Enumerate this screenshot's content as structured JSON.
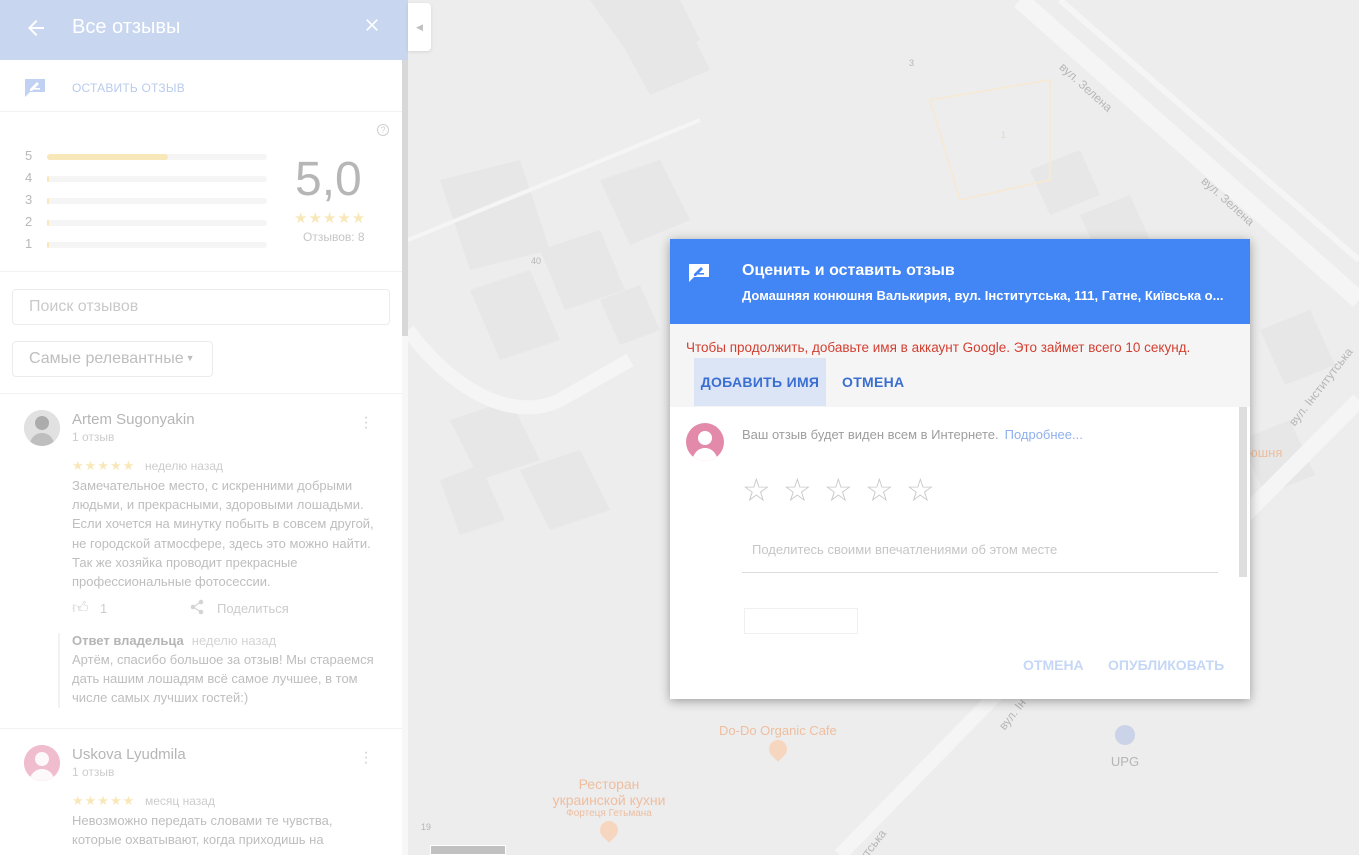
{
  "panel": {
    "title": "Все отзывы",
    "back_icon": "arrow-left-icon",
    "close_icon": "close-icon",
    "write_review_label": "ОСТАВИТЬ ОТЗЫВ",
    "rating": {
      "value": "5,0",
      "stars": "★★★★★",
      "count_label": "Отзывов: 8",
      "histogram": [
        {
          "label": "5",
          "fraction": 0.55
        },
        {
          "label": "4",
          "fraction": 0.0
        },
        {
          "label": "3",
          "fraction": 0.0
        },
        {
          "label": "2",
          "fraction": 0.0
        },
        {
          "label": "1",
          "fraction": 0.0
        }
      ]
    },
    "search_placeholder": "Поиск отзывов",
    "sort_label": "Самые релевантные",
    "reviews": [
      {
        "author": "Artem Sugonyakin",
        "count": "1 отзыв",
        "stars": "★★★★★",
        "when": "неделю назад",
        "text": "Замечательное место, с искренними добрыми людьми, и прекрасными, здоровыми лошадьми. Если хочется на минутку побыть в совсем другой, не городской атмосфере, здесь  это можно найти. Так же хозяйка проводит прекрасные профессиональные фотосессии.",
        "likes": "1",
        "share_label": "Поделиться",
        "owner_reply": {
          "head": "Ответ владельца",
          "when": "неделю назад",
          "text": "Артём, спасибо большое за отзыв! Мы стараемся дать нашим лошадям всё самое лучшее, в том числе самых лучших гостей:)"
        }
      },
      {
        "author": "Uskova Lyudmila",
        "count": "1 отзыв",
        "stars": "★★★★★",
        "when": "месяц назад",
        "text": "Невозможно передать словами те чувства, которые охватывают, когда приходишь на"
      }
    ]
  },
  "map": {
    "streets": [
      "вул. Зелена",
      "вул. Зелена",
      "вул. Інститутська",
      "вул. Ін",
      "утська"
    ],
    "numbers": [
      "3",
      "1",
      "40",
      "19"
    ],
    "pois": [
      {
        "name": "Do-Do Organic Cafe",
        "color": "#e8a57a"
      },
      {
        "name": "UPG",
        "color": "#9a9a9a"
      },
      {
        "name": "Ресторан",
        "color": "#e8a57a"
      },
      {
        "name": "украинской кухни",
        "color": "#e8a57a"
      },
      {
        "name": "Фортеця Гетьмана",
        "color": "#e8a57a"
      }
    ],
    "partial_label": "юшня"
  },
  "dialog": {
    "title": "Оценить и оставить отзыв",
    "subtitle": "Домашняя конюшня Валькирия, вул. Інститутська, 111, Гатне, Київська о...",
    "notice": "Чтобы продолжить, добавьте имя в аккаунт Google. Это займет всего 10 секунд.",
    "add_name_label": "ДОБАВИТЬ ИМЯ",
    "notice_cancel_label": "ОТМЕНА",
    "visibility_text": "Ваш отзыв будет виден всем в Интернете.",
    "more_link": "Подробнее...",
    "star_glyph": "☆",
    "comment_placeholder": "Поделитесь своими впечатлениями об этом месте",
    "cancel_label": "ОТМЕНА",
    "publish_label": "ОПУБЛИКОВАТЬ"
  },
  "colors": {
    "header_blue": "#4285f4",
    "error_red": "#d23f31",
    "star_yellow": "#f6e09e"
  }
}
